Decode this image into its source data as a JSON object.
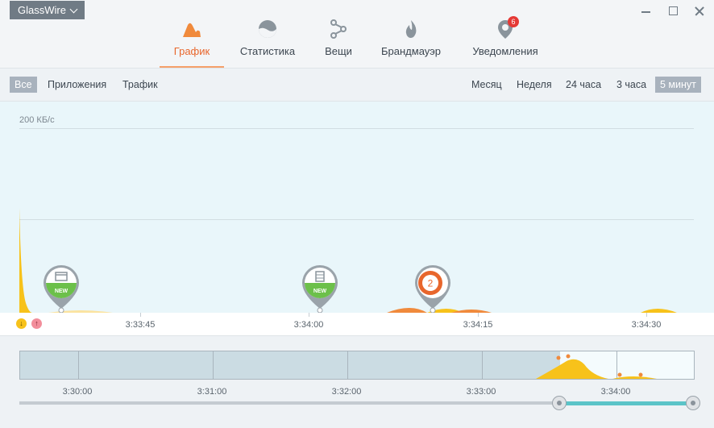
{
  "app": {
    "brand_label": "GlassWire"
  },
  "tabs": [
    {
      "label": "График",
      "icon": "graph-icon",
      "active": true
    },
    {
      "label": "Статистика",
      "icon": "stats-icon"
    },
    {
      "label": "Вещи",
      "icon": "things-icon"
    },
    {
      "label": "Брандмауэр",
      "icon": "firewall-icon"
    },
    {
      "label": "Уведомления",
      "icon": "alerts-icon",
      "badge": "6"
    }
  ],
  "filters": {
    "all": "Все",
    "apps": "Приложения",
    "traffic": "Трафик"
  },
  "ranges": {
    "month": "Месяц",
    "week": "Неделя",
    "day": "24 часа",
    "three_h": "3 часа",
    "five_min": "5 минут"
  },
  "graph": {
    "scale_label": "200 КБ/с",
    "download_icon": "↓",
    "upload_icon": "↑",
    "time_labels": [
      "3:33:45",
      "3:34:00",
      "3:34:15",
      "3:34:30"
    ],
    "pins": [
      {
        "type": "new-app",
        "label": "NEW",
        "icon": "window-icon"
      },
      {
        "type": "new-app",
        "label": "NEW",
        "icon": "server-icon"
      },
      {
        "type": "alert-group",
        "count": "2"
      }
    ],
    "colors": {
      "download": "#f7c21b",
      "upload": "#f08a3c",
      "accent": "#e8662c"
    }
  },
  "overview": {
    "time_labels": [
      "3:30:00",
      "3:31:00",
      "3:32:00",
      "3:33:00",
      "3:34:00"
    ]
  }
}
